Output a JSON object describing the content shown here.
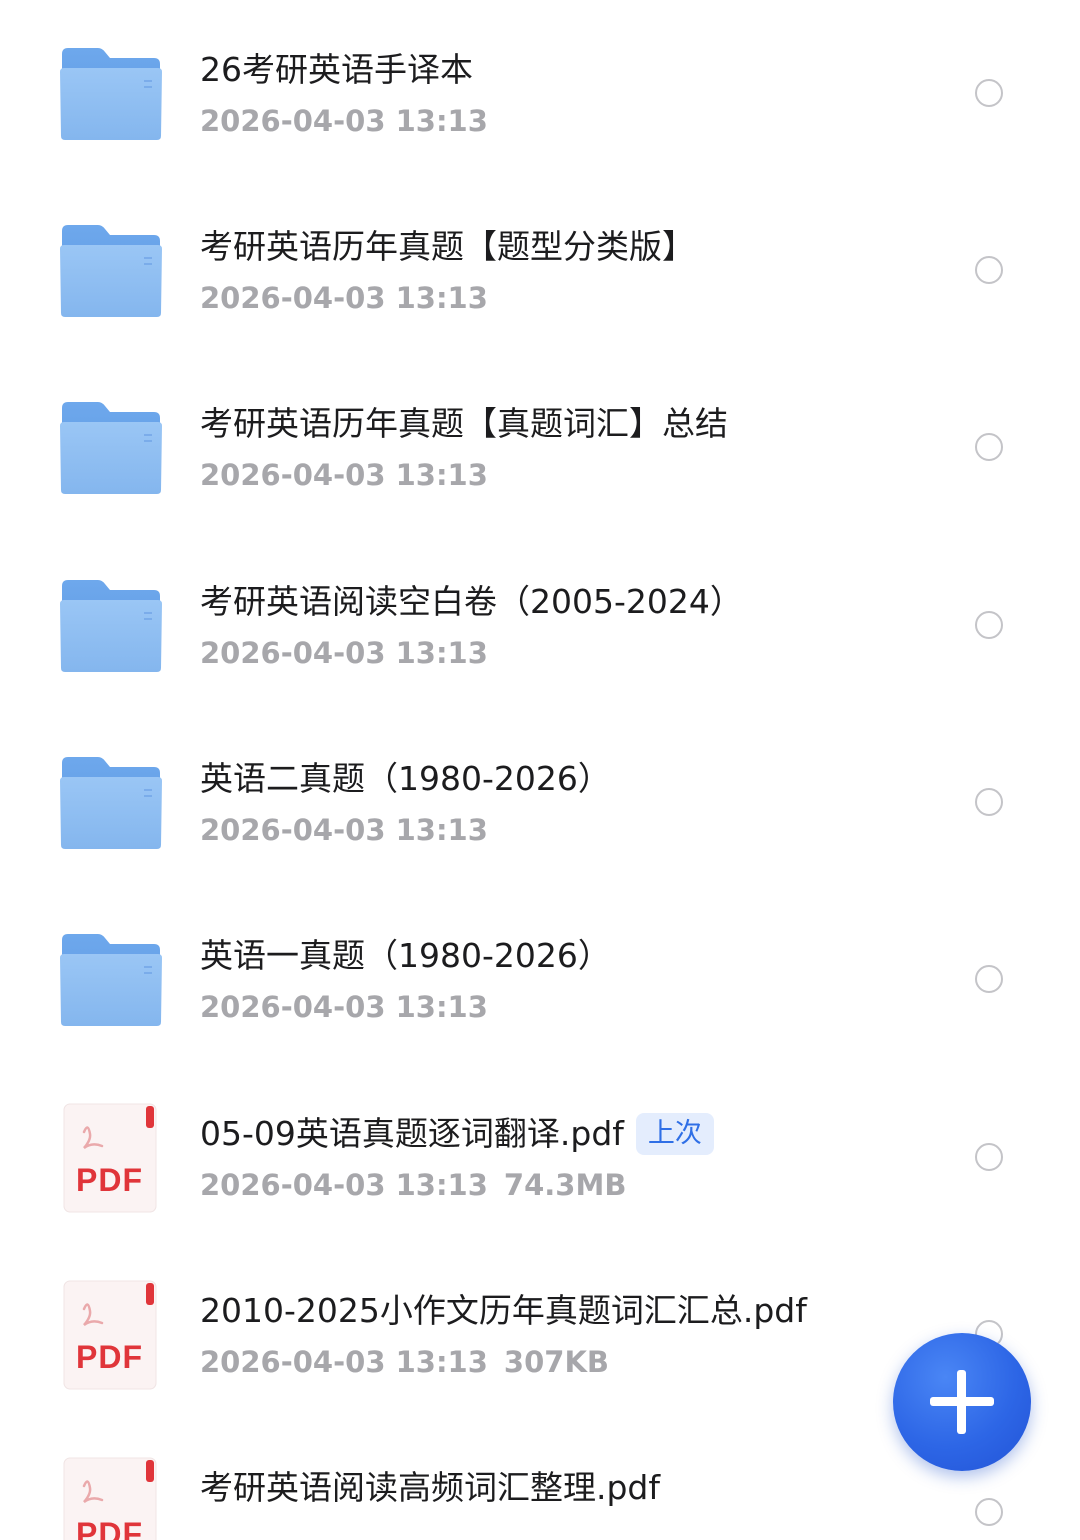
{
  "files": [
    {
      "type": "folder",
      "icon": "folder-icon",
      "name": "26考研英语手译本",
      "date": "2026-04-03 13:13",
      "size": "",
      "badge": ""
    },
    {
      "type": "folder",
      "icon": "folder-icon",
      "name": "考研英语历年真题【题型分类版】",
      "date": "2026-04-03 13:13",
      "size": "",
      "badge": ""
    },
    {
      "type": "folder",
      "icon": "folder-icon",
      "name": "考研英语历年真题【真题词汇】总结",
      "date": "2026-04-03 13:13",
      "size": "",
      "badge": ""
    },
    {
      "type": "folder",
      "icon": "folder-icon",
      "name": "考研英语阅读空白卷（2005-2024）",
      "date": "2026-04-03 13:13",
      "size": "",
      "badge": ""
    },
    {
      "type": "folder",
      "icon": "folder-icon",
      "name": "英语二真题（1980-2026）",
      "date": "2026-04-03 13:13",
      "size": "",
      "badge": ""
    },
    {
      "type": "folder",
      "icon": "folder-icon",
      "name": "英语一真题（1980-2026）",
      "date": "2026-04-03 13:13",
      "size": "",
      "badge": ""
    },
    {
      "type": "pdf",
      "icon": "pdf-file-icon",
      "pdf_label": "PDF",
      "name": "05-09英语真题逐词翻译.pdf",
      "date": "2026-04-03 13:13",
      "size": "74.3MB",
      "badge": "上次"
    },
    {
      "type": "pdf",
      "icon": "pdf-file-icon",
      "pdf_label": "PDF",
      "name": "2010-2025小作文历年真题词汇汇总.pdf",
      "date": "2026-04-03 13:13",
      "size": "307KB",
      "badge": ""
    },
    {
      "type": "pdf",
      "icon": "pdf-file-icon",
      "pdf_label": "PDF",
      "name": "考研英语阅读高频词汇整理.pdf",
      "date": "",
      "size": "",
      "badge": ""
    }
  ],
  "fab": {
    "icon": "plus-icon"
  },
  "colors": {
    "folder": "#8fbdf1",
    "pdf_red": "#e0353a",
    "badge_bg": "#e4edfd",
    "badge_text": "#2f6fe6",
    "fab": "#2d66e6"
  }
}
